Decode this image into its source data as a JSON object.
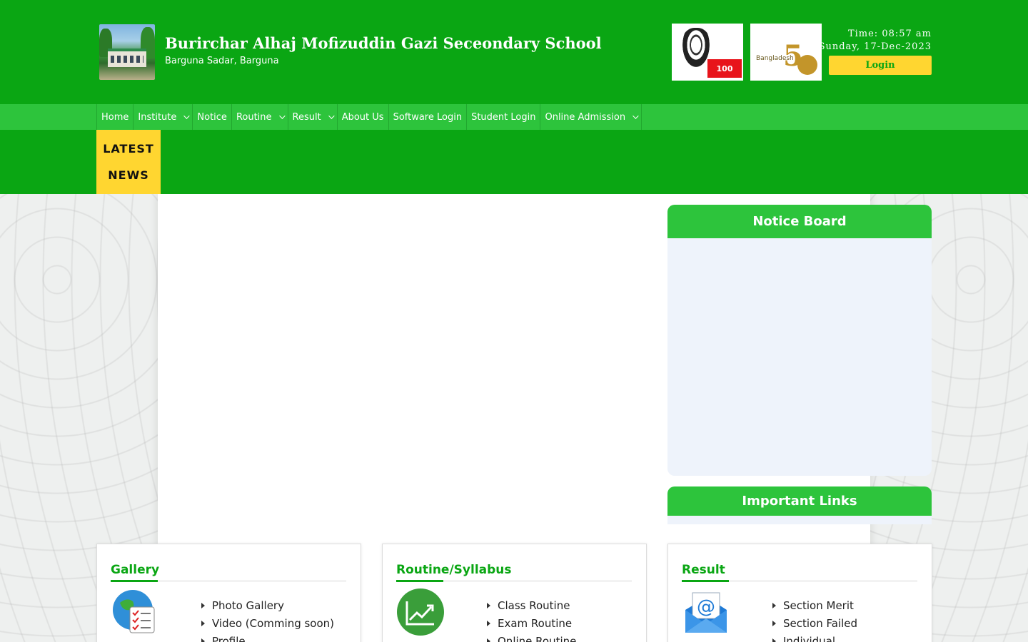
{
  "header": {
    "school_name": "Burirchar Alhaj Mofizuddin Gazi Seceondary School",
    "address": "Barguna Sadar, Barguna",
    "time": "Time: 08:57 am",
    "date": "Sunday, 17-Dec-2023",
    "login_label": "Login",
    "colors": {
      "primary": "#0aa613",
      "nav": "#2dc43c",
      "accent": "#ffd630"
    }
  },
  "nav": {
    "items": [
      {
        "label": "Home",
        "dropdown": false
      },
      {
        "label": "Institute",
        "dropdown": true
      },
      {
        "label": "Notice",
        "dropdown": false
      },
      {
        "label": "Routine",
        "dropdown": true
      },
      {
        "label": "Result",
        "dropdown": true
      },
      {
        "label": "About Us",
        "dropdown": false
      },
      {
        "label": "Software Login",
        "dropdown": false
      },
      {
        "label": "Student Login",
        "dropdown": false
      },
      {
        "label": "Online Admission",
        "dropdown": true
      }
    ]
  },
  "news": {
    "line1": "LATEST",
    "line2": "NEWS"
  },
  "sidebar": {
    "notice_title": "Notice Board",
    "links_title": "Important Links"
  },
  "cards": [
    {
      "title": "Gallery",
      "icon": "globe-checklist-icon",
      "links": [
        "Photo Gallery",
        "Video (Comming soon)",
        "Profile"
      ]
    },
    {
      "title": "Routine/Syllabus",
      "icon": "trend-chart-icon",
      "links": [
        "Class Routine",
        "Exam Routine",
        "Online Routine"
      ]
    },
    {
      "title": "Result",
      "icon": "email-envelope-icon",
      "links": [
        "Section Merit",
        "Section Failed",
        "Individual"
      ]
    }
  ]
}
